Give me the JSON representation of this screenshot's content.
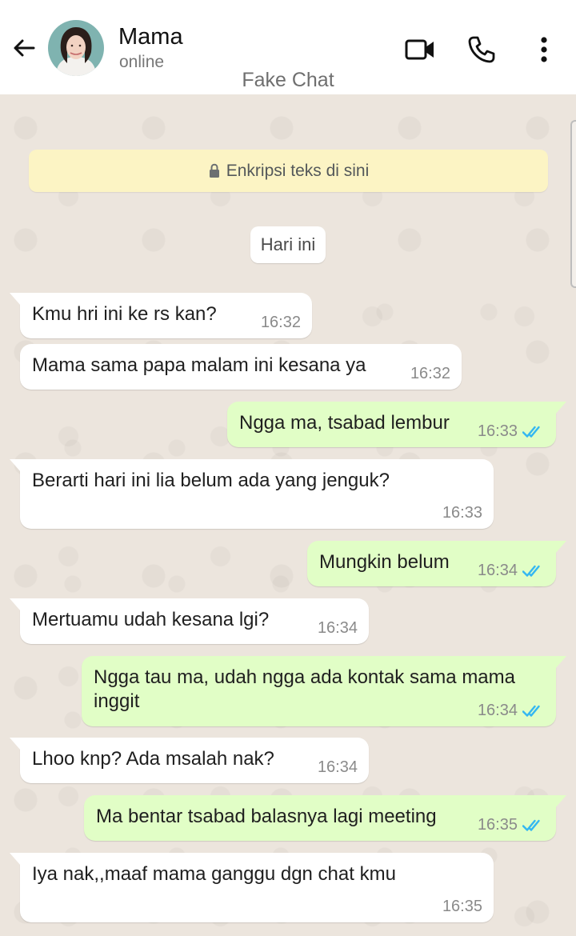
{
  "header": {
    "contact_name": "Mama",
    "status": "online",
    "watermark": "Fake Chat",
    "icons": [
      "back-arrow-icon",
      "video-call-icon",
      "phone-icon",
      "more-vertical-icon"
    ]
  },
  "chat": {
    "encryption_notice": "Enkripsi teks di sini",
    "date_label": "Hari ini",
    "messages": [
      {
        "direction": "in",
        "text": "Kmu hri ini ke rs kan?",
        "time": "16:32"
      },
      {
        "direction": "in",
        "text": "Mama sama papa malam ini kesana ya",
        "time": "16:32"
      },
      {
        "direction": "out",
        "text": "Ngga ma, tsabad lembur",
        "time": "16:33",
        "status": "read"
      },
      {
        "direction": "in",
        "text": "Berarti hari ini lia belum ada yang jenguk?",
        "time": "16:33"
      },
      {
        "direction": "out",
        "text": "Mungkin belum",
        "time": "16:34",
        "status": "read"
      },
      {
        "direction": "in",
        "text": "Mertuamu udah kesana lgi?",
        "time": "16:34"
      },
      {
        "direction": "out",
        "text": "Ngga tau ma, udah ngga ada kontak sama mama inggit",
        "time": "16:34",
        "status": "read"
      },
      {
        "direction": "in",
        "text": "Lhoo knp? Ada msalah nak?",
        "time": "16:34"
      },
      {
        "direction": "out",
        "text": "Ma bentar tsabad balasnya lagi meeting",
        "time": "16:35",
        "status": "read"
      },
      {
        "direction": "in",
        "text": "Iya nak,,maaf mama ganggu dgn chat kmu",
        "time": "16:35"
      }
    ]
  },
  "colors": {
    "background": "#ece5dd",
    "incoming_bubble": "#ffffff",
    "outgoing_bubble": "#e1fec6",
    "read_ticks": "#34b7f1",
    "encryption_banner": "#fcf4c4"
  }
}
